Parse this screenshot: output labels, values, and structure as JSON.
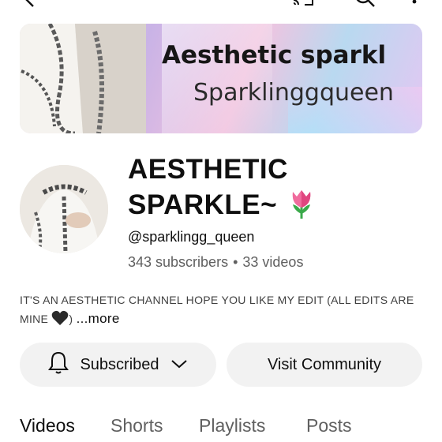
{
  "banner": {
    "title": "Aesthetic sparkl",
    "subtitle": "Sparklinggqueen"
  },
  "channel": {
    "name_line1": "AESTHETIC",
    "name_line2": "SPARKLE~",
    "name_emoji": "tulip-icon",
    "handle": "@sparklingg_queen",
    "subscribers": "343 subscribers",
    "separator": "•",
    "videos": "33 videos"
  },
  "description": {
    "text": "IT'S AN AESTHETIC CHANNEL HOPE YOU LIKE MY EDIT (ALL EDITS ARE MINE",
    "closing": ")",
    "emoji": "black-heart-icon",
    "more_label": "...more"
  },
  "actions": {
    "subscribed_label": "Subscribed",
    "community_label": "Visit Community"
  },
  "tabs": [
    {
      "label": "Videos",
      "active": true
    },
    {
      "label": "Shorts",
      "active": false
    },
    {
      "label": "Playlists",
      "active": false
    },
    {
      "label": "Posts",
      "active": false
    }
  ],
  "icons": {
    "back": "back-arrow-icon",
    "cast": "cast-icon",
    "search": "search-icon",
    "more": "more-vertical-icon",
    "bell": "bell-icon",
    "chevron": "chevron-down-icon"
  }
}
